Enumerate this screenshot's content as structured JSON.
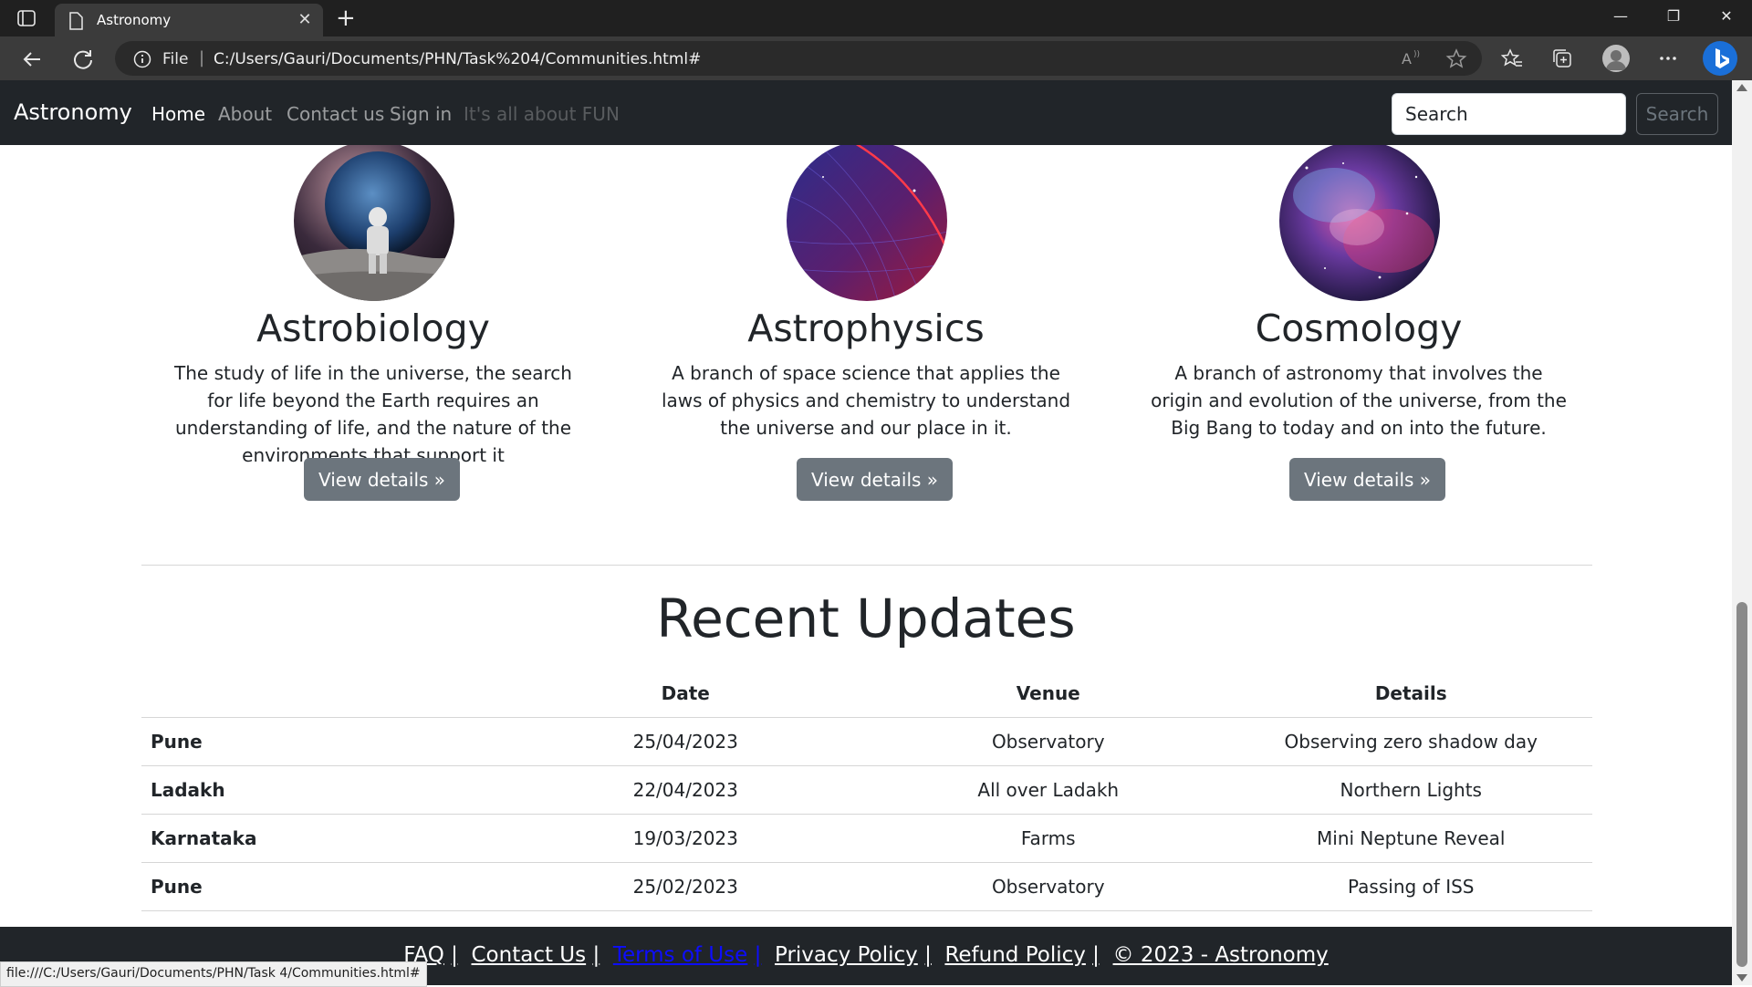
{
  "browser": {
    "tab_title": "Astronomy",
    "address_label": "File",
    "address_url": "C:/Users/Gauri/Documents/PHN/Task%204/Communities.html#",
    "status_url": "file:///C:/Users/Gauri/Documents/PHN/Task 4/Communities.html#"
  },
  "navbar": {
    "brand": "Astronomy",
    "links": [
      "Home",
      "About",
      "Contact us",
      "Sign in",
      "It's all about FUN"
    ],
    "search_placeholder": "Search",
    "search_button": "Search"
  },
  "cards": [
    {
      "title": "Astrobiology",
      "text": "The study of life in the universe, the search for life beyond the Earth requires an understanding of life, and the nature of the environments that support it",
      "button": "View details »"
    },
    {
      "title": "Astrophysics",
      "text": "A branch of space science that applies the laws of physics and chemistry to understand the universe and our place in it.",
      "button": "View details »"
    },
    {
      "title": "Cosmology",
      "text": "A branch of astronomy that involves the origin and evolution of the universe, from the Big Bang to today and on into the future.",
      "button": "View details »"
    }
  ],
  "updates": {
    "title": "Recent Updates",
    "headers": [
      "",
      "Date",
      "Venue",
      "Details"
    ],
    "rows": [
      [
        "Pune",
        "25/04/2023",
        "Observatory",
        "Observing zero shadow day"
      ],
      [
        "Ladakh",
        "22/04/2023",
        "All over Ladakh",
        "Northern Lights"
      ],
      [
        "Karnataka",
        "19/03/2023",
        "Farms",
        "Mini Neptune Reveal"
      ],
      [
        "Pune",
        "25/02/2023",
        "Observatory",
        "Passing of ISS"
      ]
    ]
  },
  "footer": {
    "links": [
      "FAQ",
      "Contact Us",
      "Terms of Use",
      "Privacy Policy",
      "Refund Policy",
      "© 2023 - Astronomy"
    ],
    "separator": "|"
  },
  "colors": {
    "navbar_bg": "#212529",
    "button_secondary": "#6c757d",
    "terms_link": "#0d0dff"
  }
}
